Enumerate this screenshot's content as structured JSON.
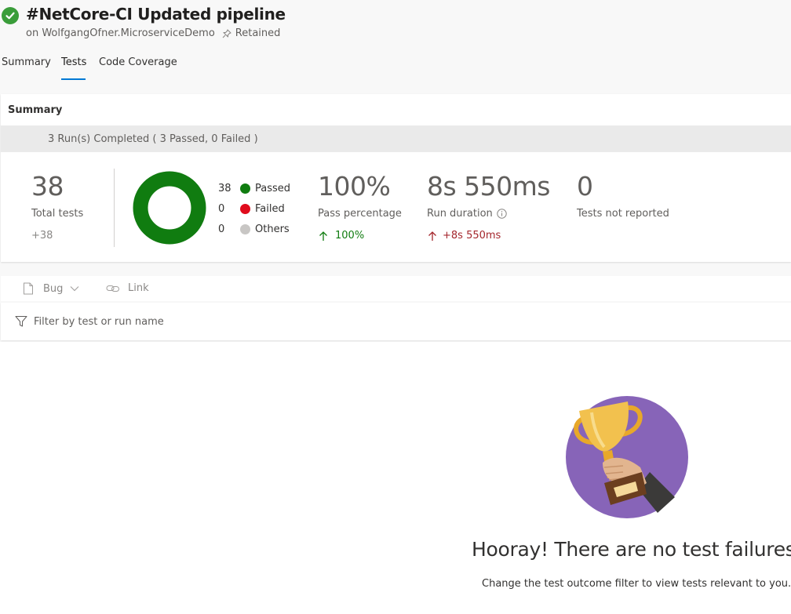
{
  "header": {
    "title": "#NetCore-CI Updated pipeline",
    "repo": "on WolfgangOfner.MicroserviceDemo",
    "retained": "Retained"
  },
  "tabs": [
    "Summary",
    "Tests",
    "Code Coverage"
  ],
  "active_tab": "Tests",
  "summary": {
    "title": "Summary",
    "runs_text": "3 Run(s) Completed ( 3 Passed, 0 Failed )",
    "total_tests": "38",
    "total_tests_label": "Total tests",
    "total_tests_delta": "+38",
    "donut": {
      "passed": 38,
      "failed": 0,
      "others": 0
    },
    "legend": [
      {
        "count": "38",
        "label": "Passed",
        "color": "#107c10"
      },
      {
        "count": "0",
        "label": "Failed",
        "color": "#e00b1c"
      },
      {
        "count": "0",
        "label": "Others",
        "color": "#c8c6c4"
      }
    ],
    "pass_percentage": "100%",
    "pass_percentage_label": "Pass percentage",
    "pass_percentage_delta": "100%",
    "run_duration": "8s 550ms",
    "run_duration_label": "Run duration",
    "run_duration_delta": "+8s 550ms",
    "not_reported": "0",
    "not_reported_label": "Tests not reported"
  },
  "toolbar": {
    "bug_label": "Bug",
    "link_label": "Link",
    "filter_placeholder": "Filter by test or run name"
  },
  "empty_state": {
    "title": "Hooray! There are no test failures.",
    "hint": "Change the test outcome filter to view tests relevant to you."
  },
  "colors": {
    "accent": "#0078d4",
    "success": "#107c10",
    "error": "#a4262c",
    "trophy_bg": "#8764b8"
  }
}
